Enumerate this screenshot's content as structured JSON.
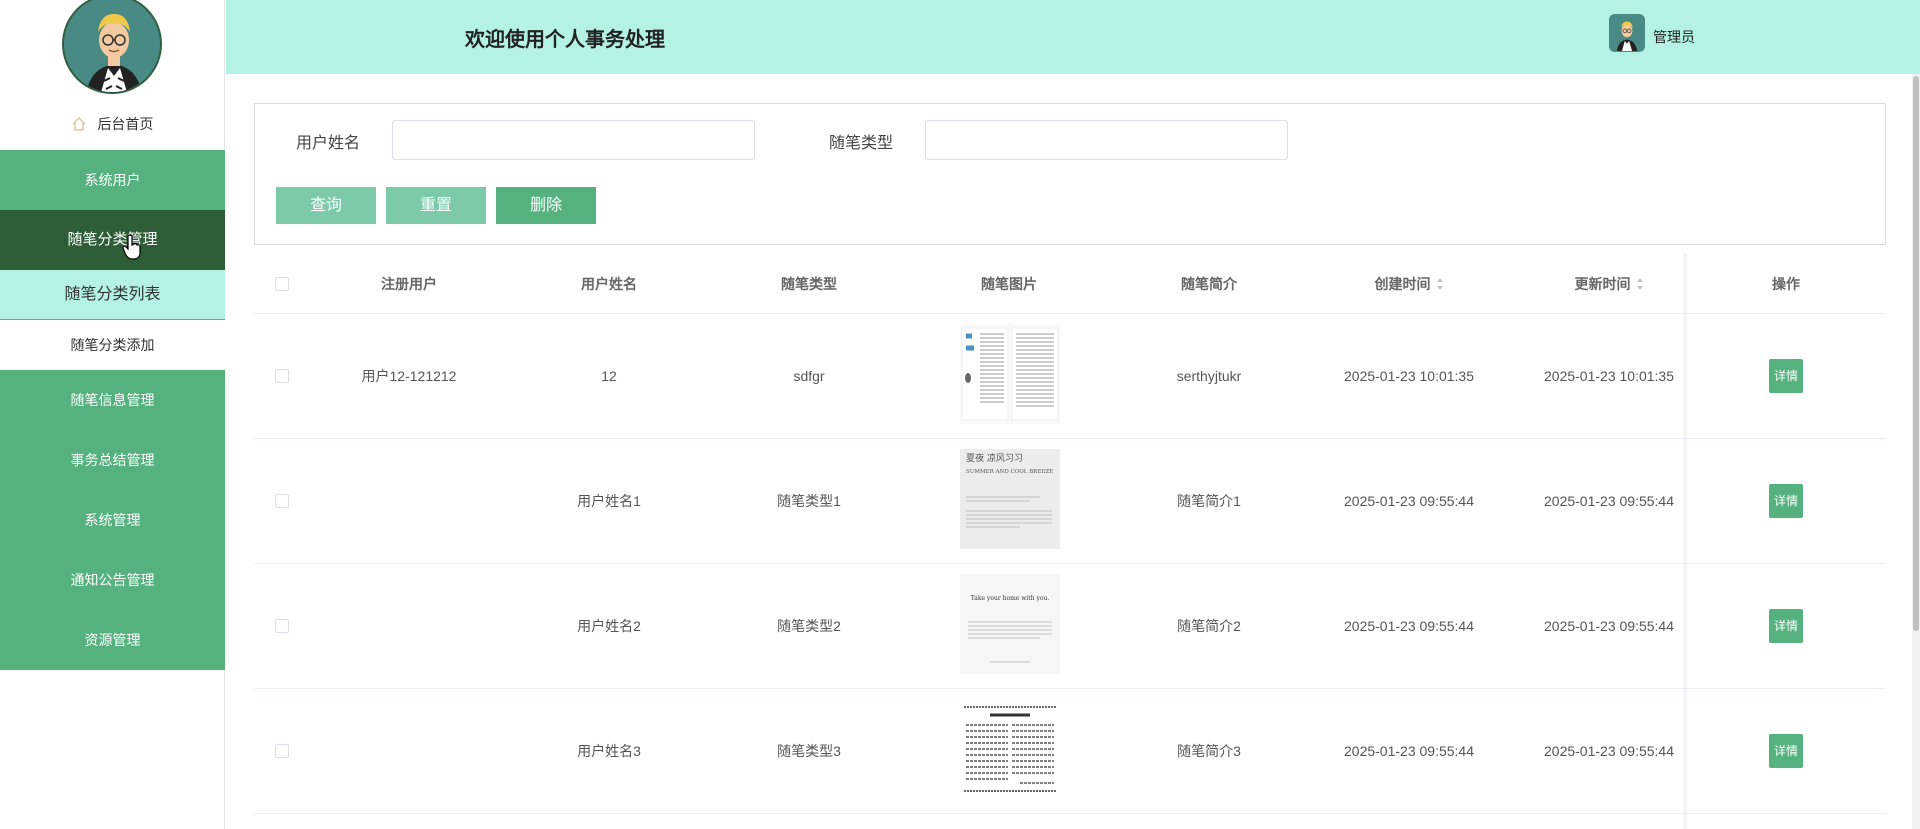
{
  "sidebar": {
    "home_label": "后台首页",
    "menu": {
      "system_users": "系统用户",
      "essay_category_mgmt": "随笔分类管理",
      "essay_category_list": "随笔分类列表",
      "essay_category_add": "随笔分类添加",
      "essay_info_mgmt": "随笔信息管理",
      "affair_summary_mgmt": "事务总结管理",
      "system_mgmt": "系统管理",
      "notice_mgmt": "通知公告管理",
      "resource_mgmt": "资源管理"
    }
  },
  "header": {
    "title": "欢迎使用个人事务处理",
    "user_name": "管理员"
  },
  "search": {
    "user_name_label": "用户姓名",
    "user_name_value": "",
    "essay_type_label": "随笔类型",
    "essay_type_value": "",
    "query_button": "查询",
    "reset_button": "重置",
    "delete_button": "删除"
  },
  "table": {
    "headers": {
      "registered_user": "注册用户",
      "user_name": "用户姓名",
      "essay_type": "随笔类型",
      "essay_image": "随笔图片",
      "essay_intro": "随笔简介",
      "created_time": "创建时间",
      "updated_time": "更新时间",
      "actions": "操作"
    },
    "rows": [
      {
        "registered_user": "用户12-121212",
        "user_name": "12",
        "essay_type": "sdfgr",
        "essay_intro": "serthyjtukr",
        "created_time": "2025-01-23 10:01:35",
        "updated_time": "2025-01-23 10:01:35",
        "detail": "详情"
      },
      {
        "registered_user": "",
        "user_name": "用户姓名1",
        "essay_type": "随笔类型1",
        "essay_intro": "随笔简介1",
        "created_time": "2025-01-23 09:55:44",
        "updated_time": "2025-01-23 09:55:44",
        "detail": "详情",
        "thumb_text": {
          "title": "夏夜 凉风习习",
          "subtitle": "SUMMER AND COOL BREEZE"
        }
      },
      {
        "registered_user": "",
        "user_name": "用户姓名2",
        "essay_type": "随笔类型2",
        "essay_intro": "随笔简介2",
        "created_time": "2025-01-23 09:55:44",
        "updated_time": "2025-01-23 09:55:44",
        "detail": "详情",
        "thumb_text": {
          "title": "Take your home with you."
        }
      },
      {
        "registered_user": "",
        "user_name": "用户姓名3",
        "essay_type": "随笔类型3",
        "essay_intro": "随笔简介3",
        "created_time": "2025-01-23 09:55:44",
        "updated_time": "2025-01-23 09:55:44",
        "detail": "详情"
      }
    ]
  },
  "colors": {
    "primary_green": "#55b27f",
    "dark_green": "#2d5e37",
    "light_mint": "#b3f2e4",
    "button_light": "#7ccaa8"
  }
}
